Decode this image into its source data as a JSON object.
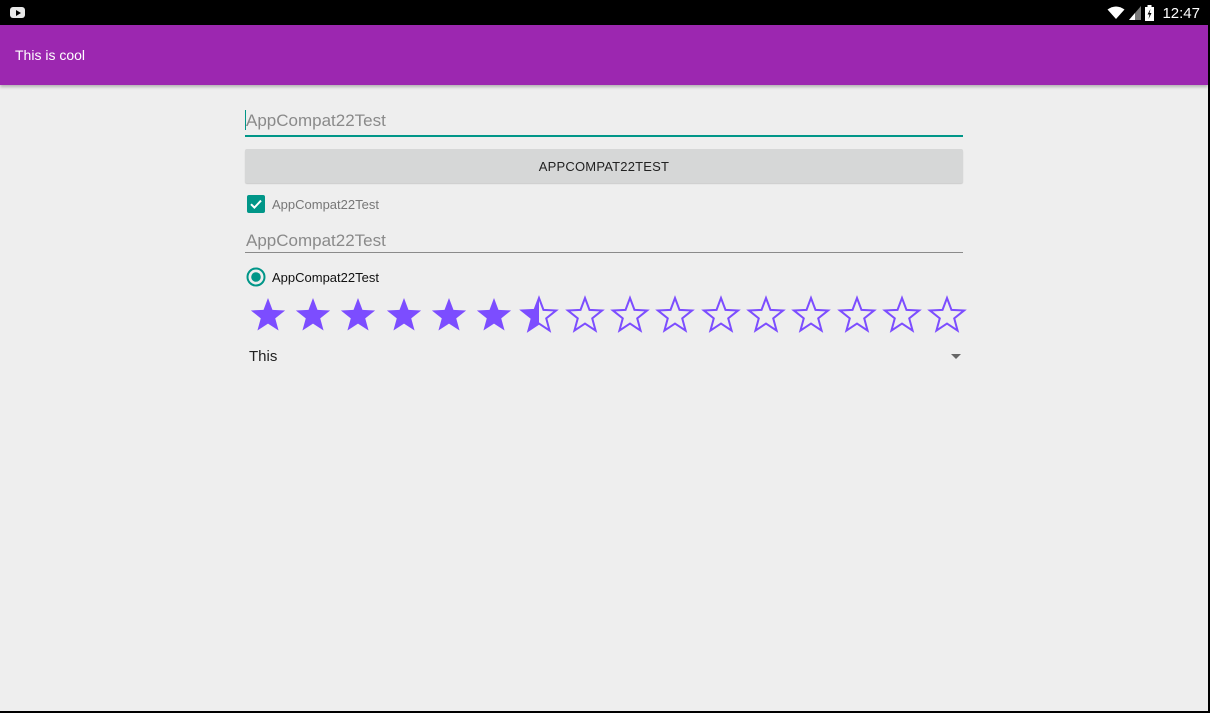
{
  "status_bar": {
    "time": "12:47",
    "icons": [
      "youtube-notification-icon",
      "wifi-icon",
      "cell-signal-icon",
      "battery-charging-icon"
    ]
  },
  "app_bar": {
    "title": "This is cool",
    "color": "#9c27b0"
  },
  "form": {
    "edit_text_1": {
      "value": "",
      "placeholder": "AppCompat22Test"
    },
    "button": {
      "label": "APPCOMPAT22TEST"
    },
    "checkbox": {
      "label": "AppCompat22Test",
      "checked": true
    },
    "edit_text_2": {
      "value": "",
      "placeholder": "AppCompat22Test"
    },
    "radio": {
      "label": "AppCompat22Test",
      "selected": true
    },
    "rating_bar": {
      "num_stars": 16,
      "rating": 6.5,
      "color": "#7c4dff"
    },
    "spinner": {
      "selected": "This"
    }
  },
  "colors": {
    "accent": "#009688",
    "primary": "#9c27b0",
    "background": "#eeeeee"
  }
}
